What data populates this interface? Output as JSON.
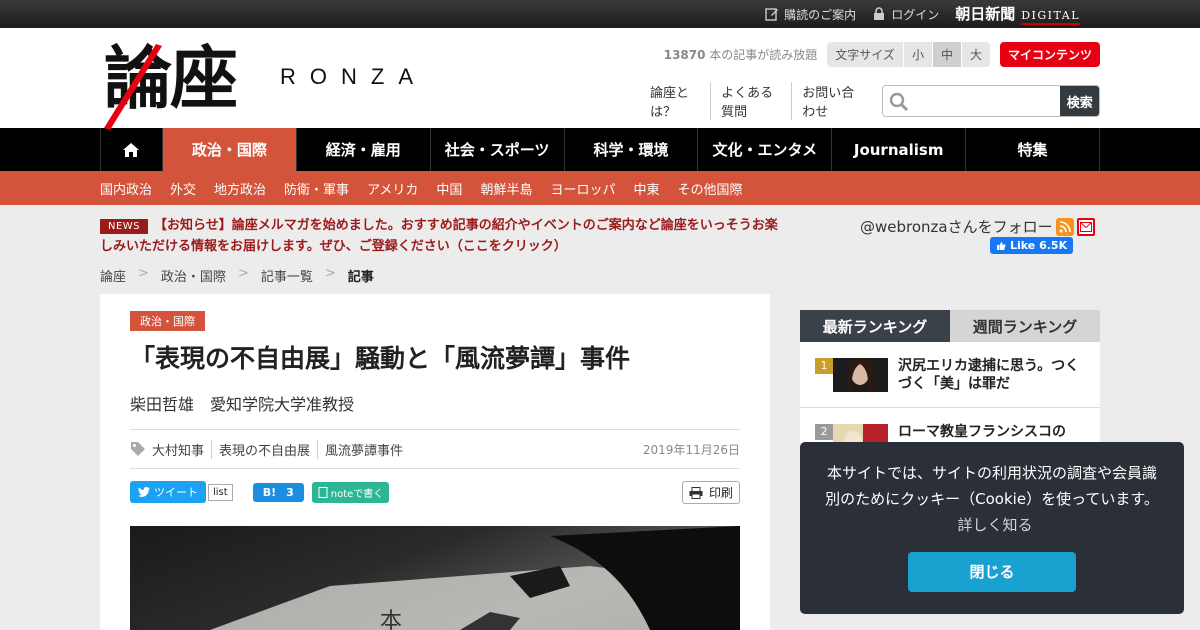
{
  "topbar": {
    "subscribe": "購読のご案内",
    "login": "ログイン",
    "asahi_jp": "朝日新聞",
    "asahi_digital": "DIGITAL"
  },
  "header": {
    "logo_kanji": "論座",
    "logo_romaji": "RONZA",
    "article_count_number": "13870",
    "article_count_text": " 本の記事が読み放題",
    "font_size_label": "文字サイズ",
    "font_sizes": [
      "小",
      "中",
      "大"
    ],
    "font_size_selected": "中",
    "my_contents": "マイコンテンツ",
    "links": [
      "論座とは？",
      "よくある質問",
      "お問い合わせ"
    ],
    "search_placeholder": "",
    "search_button": "検索"
  },
  "nav": {
    "items": [
      "政治・国際",
      "経済・雇用",
      "社会・スポーツ",
      "科学・環境",
      "文化・エンタメ",
      "Journalism",
      "特集"
    ],
    "active": "政治・国際",
    "sub_items": [
      "国内政治",
      "外交",
      "地方政治",
      "防衛・軍事",
      "アメリカ",
      "中国",
      "朝鮮半島",
      "ヨーロッパ",
      "中東",
      "その他国際"
    ]
  },
  "notice": {
    "badge": "NEWS",
    "text": "【お知らせ】論座メルマガを始めました。おすすめ記事の紹介やイベントのご案内など論座をいっそうお楽しみいただける情報をお届けします。ぜひ、ご登録ください（ここをクリック）"
  },
  "follow": {
    "text": "@webronzaさんをフォロー",
    "fb_like": "Like 6.5K"
  },
  "breadcrumb": {
    "items": [
      "論座",
      "政治・国際",
      "記事一覧",
      "記事"
    ],
    "sep": ">"
  },
  "article": {
    "category": "政治・国際",
    "title": "「表現の不自由展」騒動と「風流夢譚」事件",
    "author": "柴田哲雄　愛知学院大学准教授",
    "tags": [
      "大村知事",
      "表現の不自由展",
      "風流夢譚事件"
    ],
    "date": "2019年11月26日",
    "share": {
      "tweet": "ツイート",
      "tweet_count": "list",
      "hatena_label": "B!",
      "hatena_count": "3",
      "note": "noteで書く",
      "print": "印刷"
    }
  },
  "ranking": {
    "tab_latest": "最新ランキング",
    "tab_weekly": "週間ランキング",
    "items": [
      {
        "rank": "1",
        "title": "沢尻エリカ逮捕に思う。つくづく「美」は罪だ"
      },
      {
        "rank": "2",
        "title": "ローマ教皇フランシスコの"
      }
    ]
  },
  "cookie": {
    "text": "本サイトでは、サイトの利用状況の調査や会員識別のためにクッキー（Cookie）を使っています。",
    "more": "詳しく知る",
    "close": "閉じる"
  },
  "colors": {
    "accent": "#d4533b",
    "brand_red": "#e60012",
    "notice_red": "#9b1b1b",
    "cookie_bg": "#2b2f38",
    "cookie_btn": "#19a1cf"
  }
}
